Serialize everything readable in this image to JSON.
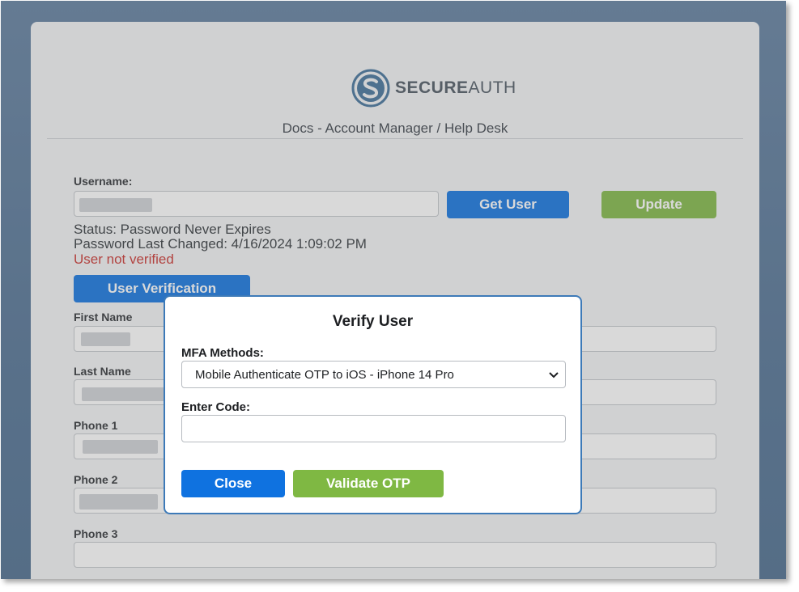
{
  "brand": {
    "name_bold": "SECURE",
    "name_light": "AUTH"
  },
  "page": {
    "subtitle": "Docs - Account Manager / Help Desk"
  },
  "username": {
    "label": "Username:",
    "value": ""
  },
  "buttons": {
    "get_user": "Get User",
    "update": "Update",
    "user_verification": "User Verification"
  },
  "status": {
    "status_text": "Status: Password Never Expires",
    "last_changed": "Password Last Changed: 4/16/2024 1:09:02 PM",
    "verification": "User not verified"
  },
  "fields": [
    {
      "label": "First Name",
      "value": ""
    },
    {
      "label": "Last Name",
      "value": ""
    },
    {
      "label": "Phone 1",
      "value": ""
    },
    {
      "label": "Phone 2",
      "value": ""
    },
    {
      "label": "Phone 3",
      "value": ""
    }
  ],
  "modal": {
    "title": "Verify User",
    "mfa_label": "MFA Methods:",
    "mfa_selected": "Mobile Authenticate OTP to iOS - iPhone 14 Pro",
    "code_label": "Enter Code:",
    "code_value": "",
    "close_button": "Close",
    "validate_button": "Validate OTP"
  },
  "colors": {
    "primary_blue": "#0f72e0",
    "green": "#7fb843",
    "modal_border": "#3d7ab8",
    "error_red": "#c9302c"
  }
}
